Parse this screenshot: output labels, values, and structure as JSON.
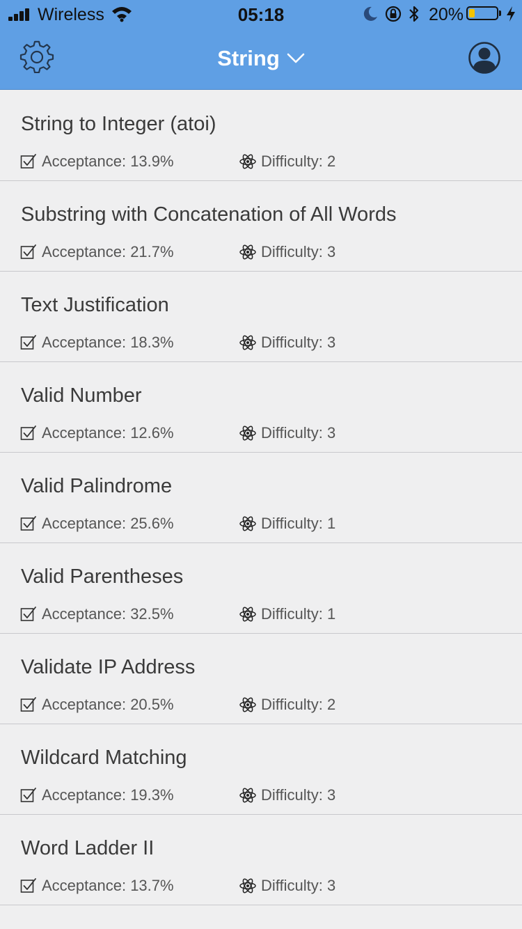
{
  "status_bar": {
    "carrier": "Wireless",
    "time": "05:18",
    "battery_percent_text": "20%",
    "battery_level": 0.2
  },
  "nav": {
    "title": "String",
    "icons": {
      "settings": "gear-icon",
      "title_dropdown": "chevron-down-icon",
      "profile": "user-avatar-icon"
    }
  },
  "problems": [
    {
      "title": "String to Integer (atoi)",
      "acceptance": "Acceptance: 13.9%",
      "difficulty": "Difficulty: 2"
    },
    {
      "title": "Substring with Concatenation of All Words",
      "acceptance": "Acceptance: 21.7%",
      "difficulty": "Difficulty: 3"
    },
    {
      "title": "Text Justification",
      "acceptance": "Acceptance: 18.3%",
      "difficulty": "Difficulty: 3"
    },
    {
      "title": "Valid Number",
      "acceptance": "Acceptance: 12.6%",
      "difficulty": "Difficulty: 3"
    },
    {
      "title": "Valid Palindrome",
      "acceptance": "Acceptance: 25.6%",
      "difficulty": "Difficulty: 1"
    },
    {
      "title": "Valid Parentheses",
      "acceptance": "Acceptance: 32.5%",
      "difficulty": "Difficulty: 1"
    },
    {
      "title": "Validate IP Address",
      "acceptance": "Acceptance: 20.5%",
      "difficulty": "Difficulty: 2"
    },
    {
      "title": "Wildcard Matching",
      "acceptance": "Acceptance: 19.3%",
      "difficulty": "Difficulty: 3"
    },
    {
      "title": "Word Ladder II",
      "acceptance": "Acceptance: 13.7%",
      "difficulty": "Difficulty: 3"
    }
  ],
  "colors": {
    "header_bg": "#5f9fe4",
    "list_bg": "#efeff0",
    "title_text": "#3a3a3a",
    "meta_text": "#555555",
    "battery_fill": "#f5c400"
  },
  "row_icons": {
    "acceptance": "checkbox-checked-icon",
    "difficulty": "atom-icon"
  }
}
